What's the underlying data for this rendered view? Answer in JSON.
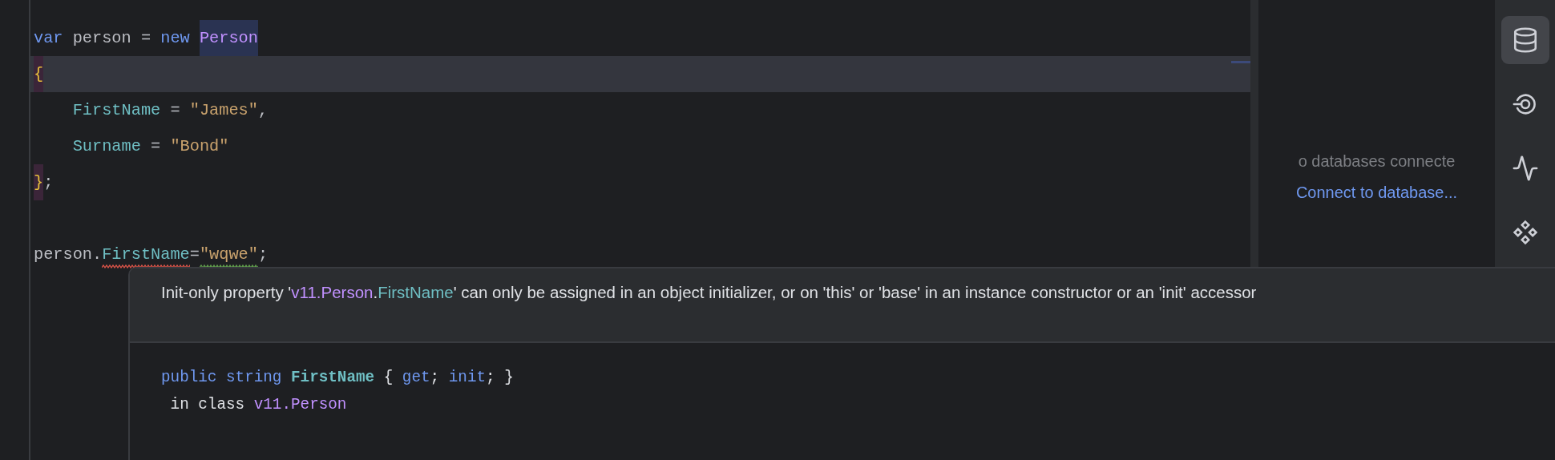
{
  "editor": {
    "lines": [
      {
        "current": false,
        "tokens": [
          {
            "kind": "keyword",
            "text": "var"
          },
          {
            "kind": "plain",
            "text": " person = "
          },
          {
            "kind": "keyword",
            "text": "new "
          },
          {
            "kind": "type",
            "text": "Person",
            "highlight": true
          }
        ]
      },
      {
        "current": true,
        "tokens": [
          {
            "kind": "brace",
            "text": "{",
            "highlight": true
          }
        ],
        "children": [
          {
            "current": false,
            "tokens": [
              {
                "kind": "property",
                "text": "FirstName"
              },
              {
                "kind": "plain",
                "text": " = "
              },
              {
                "kind": "string",
                "text": "\"James\""
              },
              {
                "kind": "plain",
                "text": ","
              }
            ]
          },
          {
            "current": false,
            "tokens": [
              {
                "kind": "property",
                "text": "Surname"
              },
              {
                "kind": "plain",
                "text": " = "
              },
              {
                "kind": "string",
                "text": "\"Bond\""
              }
            ]
          }
        ]
      },
      {
        "current": false,
        "tokens": [
          {
            "kind": "brace",
            "text": "}",
            "highlight": true
          },
          {
            "kind": "plain",
            "text": ";"
          }
        ]
      },
      {
        "current": false
      },
      {
        "current": false,
        "tokens": [
          {
            "kind": "plain",
            "text": "person."
          },
          {
            "kind": "property",
            "text": "FirstName",
            "error": true
          },
          {
            "kind": "plain",
            "text": "="
          },
          {
            "kind": "string",
            "text": "\"wqwe\"",
            "warning": true
          },
          {
            "kind": "plain",
            "text": ";"
          }
        ]
      }
    ]
  },
  "database_panel": {
    "message": "o databases connecte",
    "link": "Connect to database..."
  },
  "toolbar": [
    {
      "kind": "database",
      "selected": true
    },
    {
      "kind": "target",
      "selected": false
    },
    {
      "kind": "activity",
      "selected": false
    },
    {
      "kind": "diamonds",
      "selected": false
    }
  ],
  "tooltip": {
    "message": [
      {
        "kind": "plain",
        "text": "Init-only property '"
      },
      {
        "kind": "type",
        "text": "v11.Person"
      },
      {
        "kind": "plain",
        "text": "."
      },
      {
        "kind": "property",
        "text": "FirstName"
      },
      {
        "kind": "plain",
        "text": "' can only be assigned in an object initializer, or on 'this' or 'base' in an instance constructor or an 'init' accessor"
      }
    ],
    "declaration": [
      [
        {
          "kind": "keyword",
          "text": "public string "
        },
        {
          "kind": "member",
          "text": "FirstName"
        },
        {
          "kind": "plain",
          "text": " { "
        },
        {
          "kind": "keyword",
          "text": "get"
        },
        {
          "kind": "plain",
          "text": "; "
        },
        {
          "kind": "keyword",
          "text": "init"
        },
        {
          "kind": "plain",
          "text": "; }"
        }
      ],
      [
        {
          "kind": "plain",
          "text": " in class "
        },
        {
          "kind": "type",
          "text": "v11.Person"
        }
      ]
    ]
  }
}
